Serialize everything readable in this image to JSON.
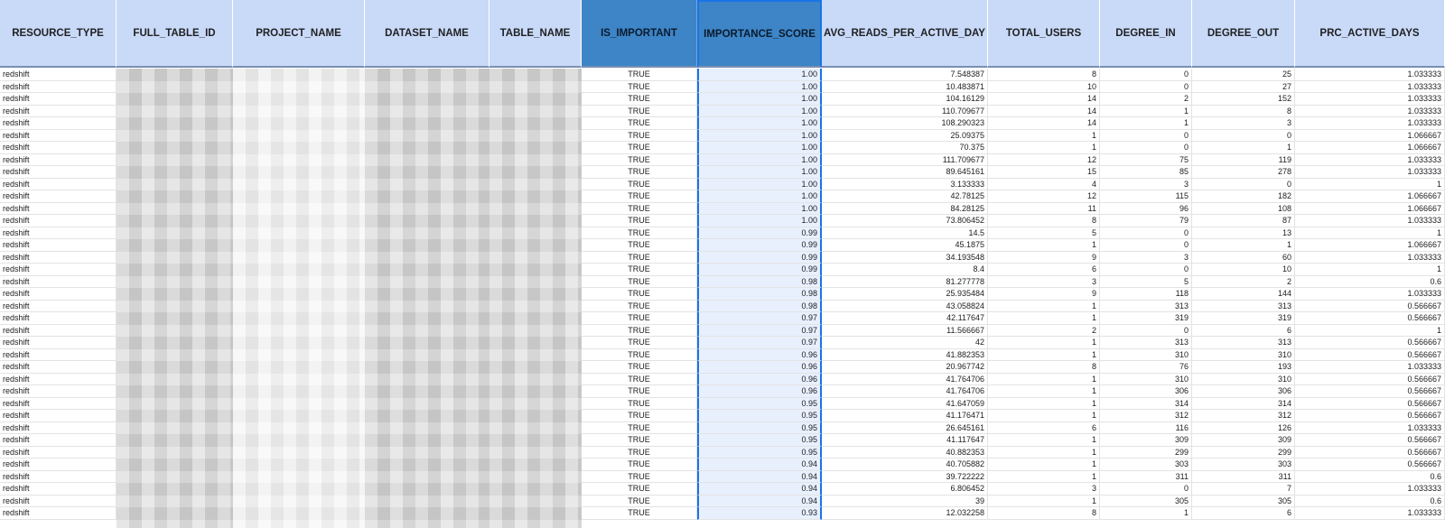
{
  "columns": [
    {
      "key": "resource_type",
      "label": "RESOURCE_TYPE"
    },
    {
      "key": "full_table_id",
      "label": "FULL_TABLE_ID"
    },
    {
      "key": "project_name",
      "label": "PROJECT_NAME"
    },
    {
      "key": "dataset_name",
      "label": "DATASET_NAME"
    },
    {
      "key": "table_name",
      "label": "TABLE_NAME"
    },
    {
      "key": "is_important",
      "label": "IS_IMPORTANT"
    },
    {
      "key": "importance_score",
      "label": "IMPORTANCE_SCORE"
    },
    {
      "key": "avg_reads",
      "label": "AVG_READS_PER_ACTIVE_DAY"
    },
    {
      "key": "total_users",
      "label": "TOTAL_USERS"
    },
    {
      "key": "degree_in",
      "label": "DEGREE_IN"
    },
    {
      "key": "degree_out",
      "label": "DEGREE_OUT"
    },
    {
      "key": "prc_active_days",
      "label": "PRC_ACTIVE_DAYS"
    }
  ],
  "rows": [
    [
      "redshift",
      "TRUE",
      "1.00",
      "7.548387",
      "8",
      "0",
      "25",
      "1.033333"
    ],
    [
      "redshift",
      "TRUE",
      "1.00",
      "10.483871",
      "10",
      "0",
      "27",
      "1.033333"
    ],
    [
      "redshift",
      "TRUE",
      "1.00",
      "104.16129",
      "14",
      "2",
      "152",
      "1.033333"
    ],
    [
      "redshift",
      "TRUE",
      "1.00",
      "110.709677",
      "14",
      "1",
      "8",
      "1.033333"
    ],
    [
      "redshift",
      "TRUE",
      "1.00",
      "108.290323",
      "14",
      "1",
      "3",
      "1.033333"
    ],
    [
      "redshift",
      "TRUE",
      "1.00",
      "25.09375",
      "1",
      "0",
      "0",
      "1.066667"
    ],
    [
      "redshift",
      "TRUE",
      "1.00",
      "70.375",
      "1",
      "0",
      "1",
      "1.066667"
    ],
    [
      "redshift",
      "TRUE",
      "1.00",
      "111.709677",
      "12",
      "75",
      "119",
      "1.033333"
    ],
    [
      "redshift",
      "TRUE",
      "1.00",
      "89.645161",
      "15",
      "85",
      "278",
      "1.033333"
    ],
    [
      "redshift",
      "TRUE",
      "1.00",
      "3.133333",
      "4",
      "3",
      "0",
      "1"
    ],
    [
      "redshift",
      "TRUE",
      "1.00",
      "42.78125",
      "12",
      "115",
      "182",
      "1.066667"
    ],
    [
      "redshift",
      "TRUE",
      "1.00",
      "84.28125",
      "11",
      "96",
      "108",
      "1.066667"
    ],
    [
      "redshift",
      "TRUE",
      "1.00",
      "73.806452",
      "8",
      "79",
      "87",
      "1.033333"
    ],
    [
      "redshift",
      "TRUE",
      "0.99",
      "14.5",
      "5",
      "0",
      "13",
      "1"
    ],
    [
      "redshift",
      "TRUE",
      "0.99",
      "45.1875",
      "1",
      "0",
      "1",
      "1.066667"
    ],
    [
      "redshift",
      "TRUE",
      "0.99",
      "34.193548",
      "9",
      "3",
      "60",
      "1.033333"
    ],
    [
      "redshift",
      "TRUE",
      "0.99",
      "8.4",
      "6",
      "0",
      "10",
      "1"
    ],
    [
      "redshift",
      "TRUE",
      "0.98",
      "81.277778",
      "3",
      "5",
      "2",
      "0.6"
    ],
    [
      "redshift",
      "TRUE",
      "0.98",
      "25.935484",
      "9",
      "118",
      "144",
      "1.033333"
    ],
    [
      "redshift",
      "TRUE",
      "0.98",
      "43.058824",
      "1",
      "313",
      "313",
      "0.566667"
    ],
    [
      "redshift",
      "TRUE",
      "0.97",
      "42.117647",
      "1",
      "319",
      "319",
      "0.566667"
    ],
    [
      "redshift",
      "TRUE",
      "0.97",
      "11.566667",
      "2",
      "0",
      "6",
      "1"
    ],
    [
      "redshift",
      "TRUE",
      "0.97",
      "42",
      "1",
      "313",
      "313",
      "0.566667"
    ],
    [
      "redshift",
      "TRUE",
      "0.96",
      "41.882353",
      "1",
      "310",
      "310",
      "0.566667"
    ],
    [
      "redshift",
      "TRUE",
      "0.96",
      "20.967742",
      "8",
      "76",
      "193",
      "1.033333"
    ],
    [
      "redshift",
      "TRUE",
      "0.96",
      "41.764706",
      "1",
      "310",
      "310",
      "0.566667"
    ],
    [
      "redshift",
      "TRUE",
      "0.96",
      "41.764706",
      "1",
      "306",
      "306",
      "0.566667"
    ],
    [
      "redshift",
      "TRUE",
      "0.95",
      "41.647059",
      "1",
      "314",
      "314",
      "0.566667"
    ],
    [
      "redshift",
      "TRUE",
      "0.95",
      "41.176471",
      "1",
      "312",
      "312",
      "0.566667"
    ],
    [
      "redshift",
      "TRUE",
      "0.95",
      "26.645161",
      "6",
      "116",
      "126",
      "1.033333"
    ],
    [
      "redshift",
      "TRUE",
      "0.95",
      "41.117647",
      "1",
      "309",
      "309",
      "0.566667"
    ],
    [
      "redshift",
      "TRUE",
      "0.95",
      "40.882353",
      "1",
      "299",
      "299",
      "0.566667"
    ],
    [
      "redshift",
      "TRUE",
      "0.94",
      "40.705882",
      "1",
      "303",
      "303",
      "0.566667"
    ],
    [
      "redshift",
      "TRUE",
      "0.94",
      "39.722222",
      "1",
      "311",
      "311",
      "0.6"
    ],
    [
      "redshift",
      "TRUE",
      "0.94",
      "6.806452",
      "3",
      "0",
      "7",
      "1.033333"
    ],
    [
      "redshift",
      "TRUE",
      "0.94",
      "39",
      "1",
      "305",
      "305",
      "0.6"
    ],
    [
      "redshift",
      "TRUE",
      "0.93",
      "12.032258",
      "8",
      "1",
      "6",
      "1.033333"
    ]
  ],
  "selected_column": "IMPORTANCE_SCORE"
}
